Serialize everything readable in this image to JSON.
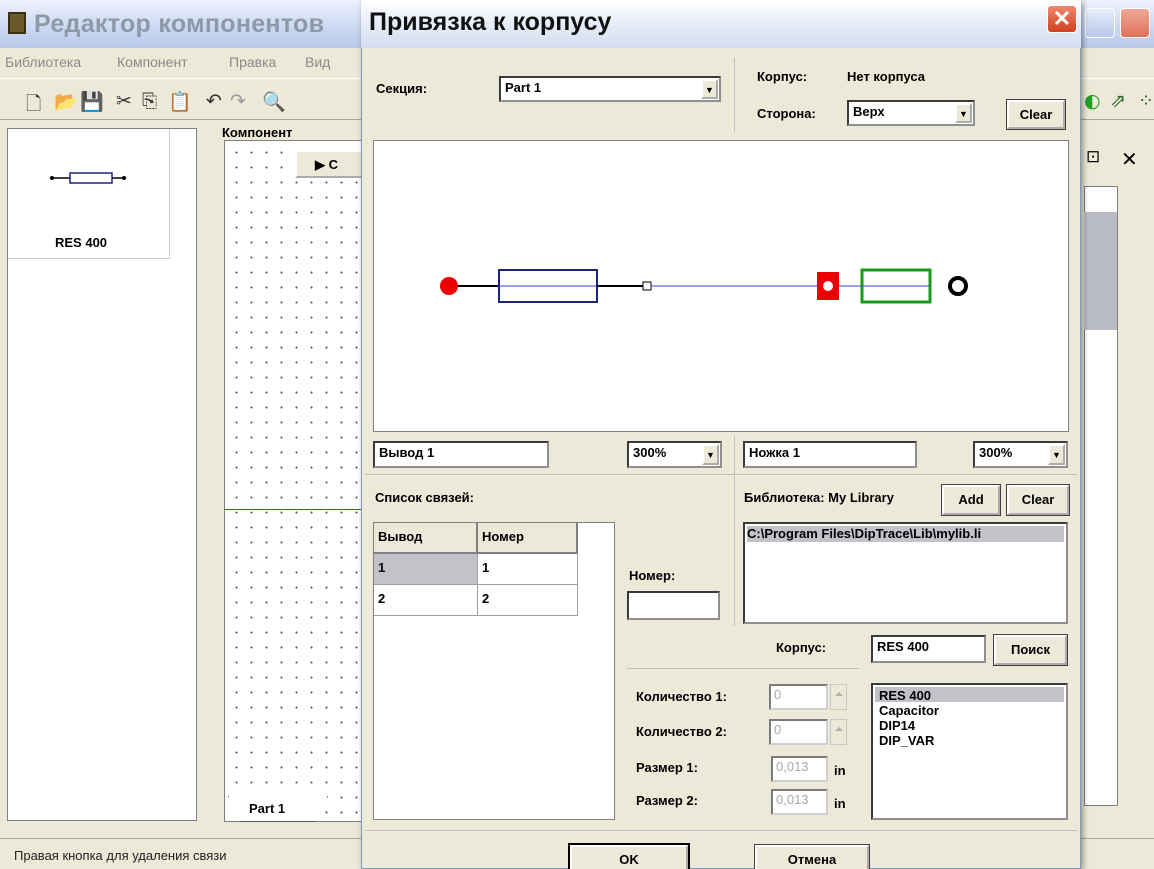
{
  "main_window": {
    "title": "Редактор компонентов",
    "menu": [
      "Библиотека",
      "Компонент",
      "Правка",
      "Вид"
    ],
    "component_card_label": "RES 400",
    "component_area_label": "Компонент",
    "canvas_button_label": "▶ С",
    "part_tab_label": "Part 1",
    "status_text": "Правая кнопка для удаления связи"
  },
  "dialog": {
    "title": "Привязка к корпусу",
    "close_glyph": "✕",
    "section_label": "Секция:",
    "section_value": "Part 1",
    "package_label": "Корпус:",
    "package_value": "Нет корпуса",
    "side_label": "Сторона:",
    "side_value": "Верх",
    "clear_label": "Clear",
    "pin_field": "Вывод 1",
    "pin_zoom": "300%",
    "pad_field": "Ножка 1",
    "pad_zoom": "300%",
    "connections_label": "Список связей:",
    "table": {
      "headers": [
        "Вывод",
        "Номер"
      ],
      "rows": [
        [
          "1",
          "1"
        ],
        [
          "2",
          "2"
        ]
      ]
    },
    "number_label": "Номер:",
    "number_value": "",
    "library_label": "Библиотека: My Library",
    "add_label": "Add",
    "library_clear_label": "Clear",
    "library_path": "C:\\Program Files\\DipTrace\\Lib\\mylib.li",
    "pkg_label": "Корпус:",
    "pkg_value": "RES 400",
    "search_label": "Поиск",
    "count1_label": "Количество 1:",
    "count1_value": "0",
    "count2_label": "Количество 2:",
    "count2_value": "0",
    "size1_label": "Размер 1:",
    "size1_value": "0,013",
    "size2_label": "Размер 2:",
    "size2_value": "0,013",
    "unit": "in",
    "packages": [
      "RES 400",
      "Capacitor",
      "DIP14",
      "DIP_VAR"
    ],
    "ok_label": "OK",
    "cancel_label": "Отмена"
  },
  "colors": {
    "pin_dot": "#ee0000",
    "resistor_symbol": "#1a237e",
    "pad_square": "#ee0000",
    "footprint": "#1a9a1a",
    "link_line": "#3b3bd0"
  }
}
